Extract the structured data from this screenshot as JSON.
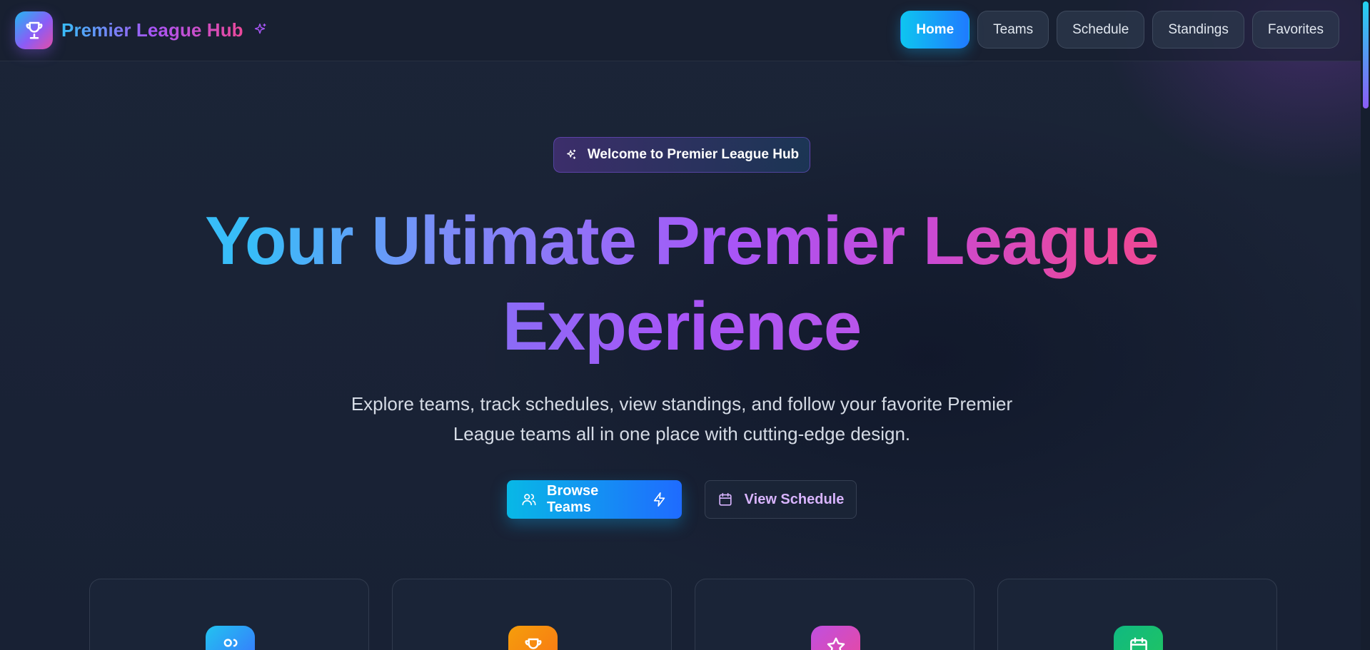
{
  "brand": {
    "name": "Premier League Hub",
    "logo_icon": "trophy-icon",
    "accent_icon": "sparkles-icon"
  },
  "nav": {
    "items": [
      {
        "label": "Home",
        "active": true
      },
      {
        "label": "Teams",
        "active": false
      },
      {
        "label": "Schedule",
        "active": false
      },
      {
        "label": "Standings",
        "active": false
      },
      {
        "label": "Favorites",
        "active": false
      }
    ]
  },
  "hero": {
    "badge": "Welcome to Premier League Hub",
    "title_line1": "Your Ultimate Premier League",
    "title_line2": "Experience",
    "subtitle_line1": "Explore teams, track schedules, view standings, and follow your favorite Premier",
    "subtitle_line2": "League teams all in one place with cutting-edge design.",
    "primary_cta": "Browse Teams",
    "secondary_cta": "View Schedule"
  },
  "feature_cards": [
    {
      "icon": "users-icon",
      "color": "#3b82f6"
    },
    {
      "icon": "trophy-icon",
      "color": "#f97316"
    },
    {
      "icon": "star-icon",
      "color": "#ec4899"
    },
    {
      "icon": "calendar-icon",
      "color": "#22c55e"
    }
  ],
  "colors": {
    "accent_blue": "#0ec5f0",
    "accent_purple": "#a855f7",
    "accent_pink": "#ec4899",
    "background": "#1a2336"
  }
}
